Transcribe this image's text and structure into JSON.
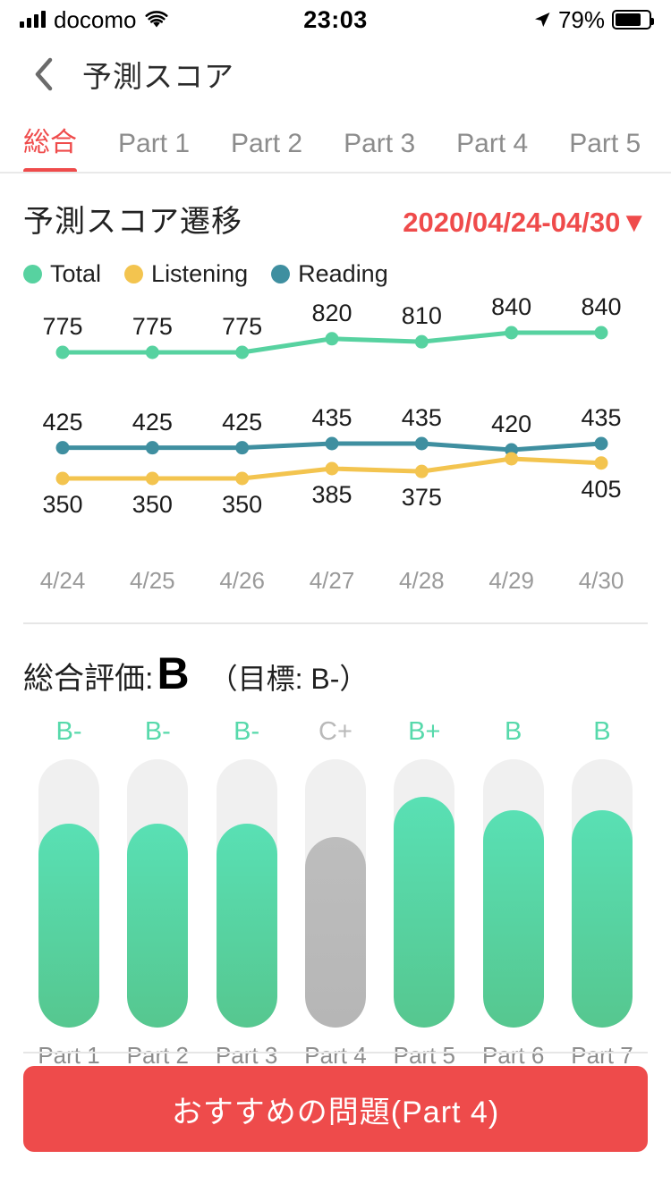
{
  "status_bar": {
    "carrier": "docomo",
    "time": "23:03",
    "battery_percent": "79%",
    "signal_icon": "signal-bars-icon",
    "wifi_icon": "wifi-icon",
    "location_icon": "location-arrow-icon",
    "battery_icon": "battery-icon"
  },
  "nav": {
    "back_icon": "back-chevron-icon",
    "title": "予測スコア"
  },
  "tabs": [
    {
      "label": "総合",
      "active": true
    },
    {
      "label": "Part 1",
      "active": false
    },
    {
      "label": "Part 2",
      "active": false
    },
    {
      "label": "Part 3",
      "active": false
    },
    {
      "label": "Part 4",
      "active": false
    },
    {
      "label": "Part 5",
      "active": false
    }
  ],
  "chart_section": {
    "title": "予測スコア遷移",
    "date_range": "2020/04/24-04/30▼"
  },
  "colors": {
    "total": "#57d2a0",
    "listening": "#f3c44f",
    "reading": "#3f8fa0",
    "accent_red": "#ee4b4b",
    "grade_green": "#57d9ab",
    "grade_muted": "#b9b9b9",
    "track_gray": "#f0f0f0",
    "bar_gray": "#bdbdbd"
  },
  "chart_data": {
    "type": "line",
    "title": "予測スコア遷移",
    "xlabel": "",
    "ylabel": "",
    "grid": false,
    "legend_position": "top-left",
    "x": [
      "4/24",
      "4/25",
      "4/26",
      "4/27",
      "4/28",
      "4/29",
      "4/30"
    ],
    "series": [
      {
        "name": "Total",
        "color": "#57d2a0",
        "values": [
          775,
          775,
          775,
          820,
          810,
          840,
          840
        ],
        "labels": [
          "775",
          "775",
          "775",
          "820",
          "810",
          "840",
          "840"
        ]
      },
      {
        "name": "Reading",
        "color": "#3f8fa0",
        "values": [
          425,
          425,
          425,
          435,
          435,
          420,
          435
        ],
        "labels": [
          "425",
          "425",
          "425",
          "435",
          "435",
          "420",
          "435"
        ]
      },
      {
        "name": "Listening",
        "color": "#f3c44f",
        "values": [
          350,
          350,
          350,
          385,
          375,
          420,
          405
        ],
        "labels": [
          "350",
          "350",
          "350",
          "385",
          "375",
          "",
          "405"
        ]
      }
    ]
  },
  "overall": {
    "label": "総合評価:",
    "value": "B",
    "target": "（目標: B-）"
  },
  "parts_chart": {
    "type": "bar",
    "categories": [
      "Part 1",
      "Part 2",
      "Part 3",
      "Part 4",
      "Part 5",
      "Part 6",
      "Part 7"
    ],
    "grades": [
      "B-",
      "B-",
      "B-",
      "C+",
      "B+",
      "B",
      "B"
    ],
    "fill_percent": [
      76,
      76,
      76,
      71,
      86,
      81,
      81
    ],
    "muted": [
      false,
      false,
      false,
      true,
      false,
      false,
      false
    ]
  },
  "cta": {
    "label": "おすすめの問題(Part 4)"
  }
}
